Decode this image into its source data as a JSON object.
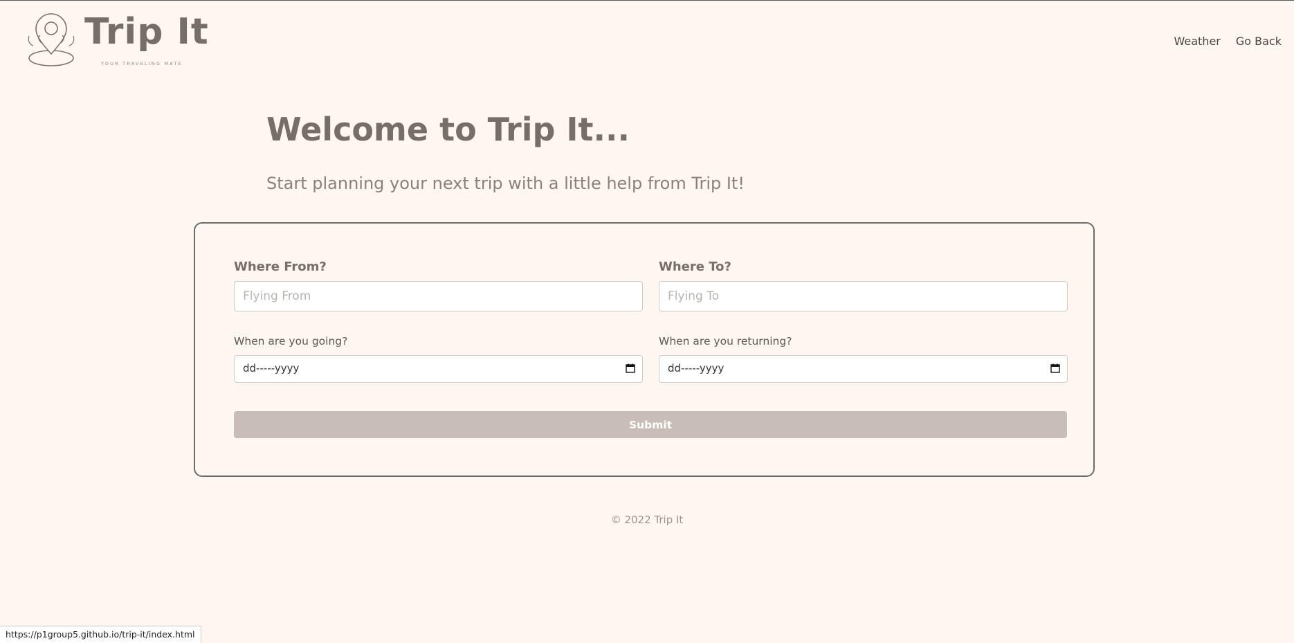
{
  "brand": {
    "name": "Trip It",
    "tagline": "YOUR TRAVELING MATE"
  },
  "nav": {
    "weather_label": "Weather",
    "go_back_label": "Go Back"
  },
  "hero": {
    "title": "Welcome to Trip It...",
    "subtitle": "Start planning your next trip with a little help from Trip It!"
  },
  "form": {
    "from_label": "Where From?",
    "from_placeholder": "Flying From",
    "to_label": "Where To?",
    "to_placeholder": "Flying To",
    "depart_label": "When are you going?",
    "depart_value": "dd-----yyyy",
    "return_label": "When are you returning?",
    "return_value": "dd-----yyyy",
    "submit_label": "Submit"
  },
  "footer": {
    "copyright": "© 2022 Trip It"
  },
  "status_bar": {
    "url": "https://p1group5.github.io/trip-it/index.html"
  },
  "colors": {
    "background": "#fdf6f1",
    "brand_text": "#776f67",
    "submit_button": "#c9bdb8",
    "card_border": "#6f6a66"
  },
  "icons": {
    "logo": "map-pin-traveler-icon",
    "date_picker": "calendar-icon"
  }
}
